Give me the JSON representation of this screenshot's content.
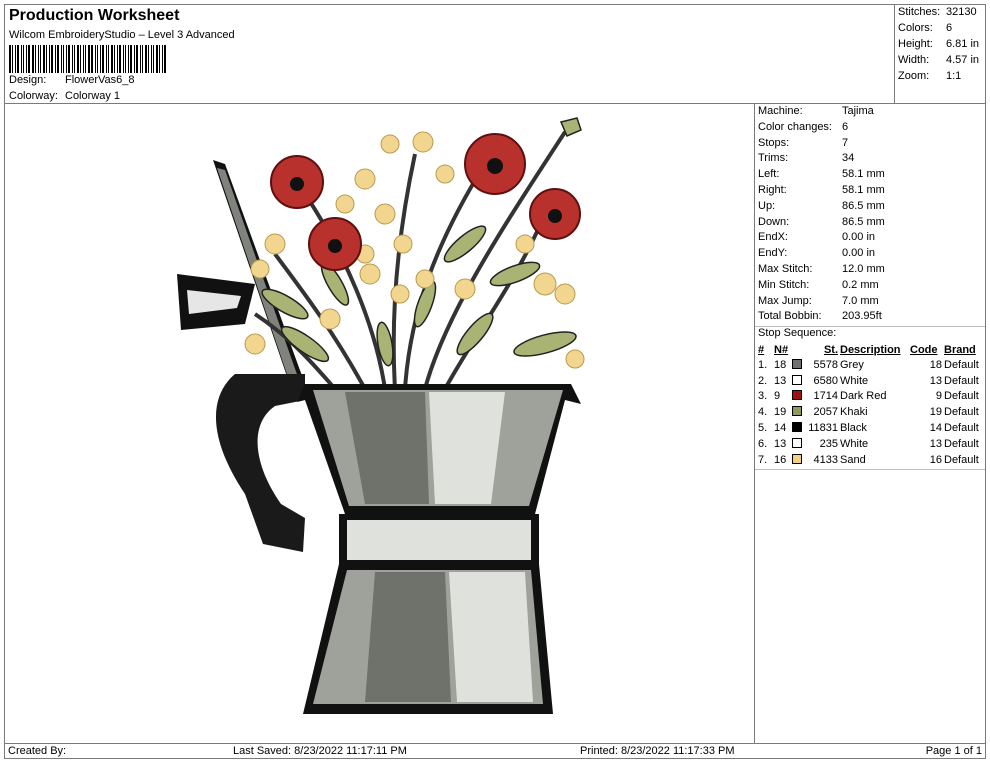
{
  "header": {
    "title": "Production Worksheet",
    "subtitle": "Wilcom EmbroideryStudio – Level 3 Advanced",
    "design_label": "Design:",
    "design_value": "FlowerVas6_8",
    "colorway_label": "Colorway:",
    "colorway_value": "Colorway 1"
  },
  "stats": [
    {
      "label": "Stitches:",
      "value": "32130"
    },
    {
      "label": "Colors:",
      "value": "6"
    },
    {
      "label": "Height:",
      "value": "6.81 in"
    },
    {
      "label": "Width:",
      "value": "4.57 in"
    },
    {
      "label": "Zoom:",
      "value": "1:1"
    }
  ],
  "machine_info": [
    {
      "label": "Machine:",
      "value": "Tajima"
    },
    {
      "label": "Color changes:",
      "value": "6"
    },
    {
      "label": "Stops:",
      "value": "7"
    },
    {
      "label": "Trims:",
      "value": "34"
    },
    {
      "label": "Left:",
      "value": "58.1 mm"
    },
    {
      "label": "Right:",
      "value": "58.1 mm"
    },
    {
      "label": "Up:",
      "value": "86.5 mm"
    },
    {
      "label": "Down:",
      "value": "86.5 mm"
    },
    {
      "label": "EndX:",
      "value": "0.00 in"
    },
    {
      "label": "EndY:",
      "value": "0.00 in"
    },
    {
      "label": "Max Stitch:",
      "value": "12.0 mm"
    },
    {
      "label": "Min Stitch:",
      "value": "0.2 mm"
    },
    {
      "label": "Max Jump:",
      "value": "7.0 mm"
    },
    {
      "label": "Total Bobbin:",
      "value": "203.95ft"
    }
  ],
  "stop_sequence": {
    "title": "Stop Sequence:",
    "headers": {
      "num": "#",
      "needle": "N#",
      "stitches": "St.",
      "description": "Description",
      "code": "Code",
      "brand": "Brand"
    },
    "rows": [
      {
        "num": "1.",
        "needle": "18",
        "color": "#707070",
        "stitches": "5578",
        "description": "Grey",
        "code": "18",
        "brand": "Default"
      },
      {
        "num": "2.",
        "needle": "13",
        "color": "#ffffff",
        "stitches": "6580",
        "description": "White",
        "code": "13",
        "brand": "Default"
      },
      {
        "num": "3.",
        "needle": "9",
        "color": "#a01010",
        "stitches": "1714",
        "description": "Dark Red",
        "code": "9",
        "brand": "Default"
      },
      {
        "num": "4.",
        "needle": "19",
        "color": "#8e9a5c",
        "stitches": "2057",
        "description": "Khaki",
        "code": "19",
        "brand": "Default"
      },
      {
        "num": "5.",
        "needle": "14",
        "color": "#000000",
        "stitches": "11831",
        "description": "Black",
        "code": "14",
        "brand": "Default"
      },
      {
        "num": "6.",
        "needle": "13",
        "color": "#ffffff",
        "stitches": "235",
        "description": "White",
        "code": "13",
        "brand": "Default"
      },
      {
        "num": "7.",
        "needle": "16",
        "color": "#f3cf82",
        "stitches": "4133",
        "description": "Sand",
        "code": "16",
        "brand": "Default"
      }
    ]
  },
  "footer": {
    "created_by": "Created By:",
    "last_saved": "Last Saved: 8/23/2022 11:17:11 PM",
    "printed": "Printed: 8/23/2022 11:17:33 PM",
    "page": "Page 1 of 1"
  },
  "palette": {
    "pot_dark": "#6e726b",
    "pot_light": "#dfe2dc",
    "pot_mid": "#9ea29a",
    "outline": "#111111",
    "red": "#b8312c",
    "red_dark": "#7a1616",
    "sand": "#f2d68f",
    "khaki": "#a9b374",
    "stem": "#3a3a3a"
  }
}
